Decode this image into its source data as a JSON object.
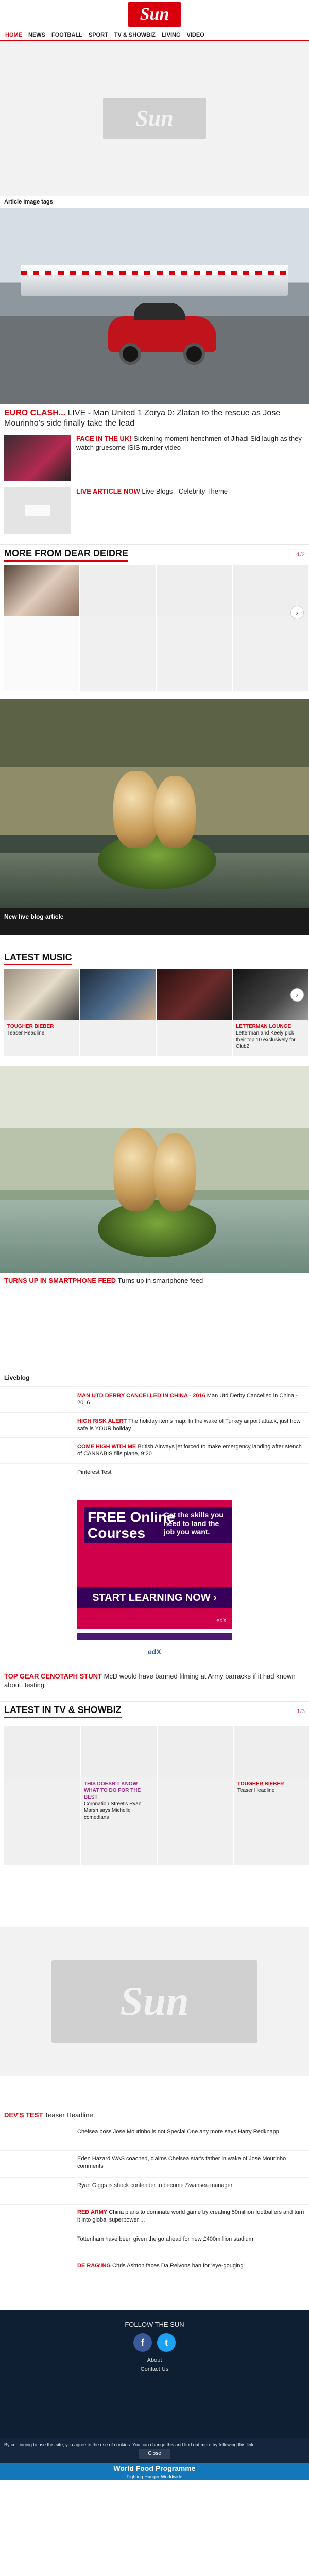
{
  "brand": {
    "name": "Sun"
  },
  "nav": [
    "Home",
    "News",
    "Football",
    "Sport",
    "TV & Showbiz",
    "Living",
    "Video"
  ],
  "article_image_tags": "Article Image tags",
  "hero": {
    "kicker": "EURO CLASH...",
    "headline": " LIVE - Man United 1 Zorya 0: Zlatan to the rescue as Jose Mourinho's side finally take the lead"
  },
  "stories": [
    {
      "kicker": "FACE IN THE UK!",
      "text": " Sickening moment henchmen of Jihadi Sid laugh as they watch gruesome ISIS murder video"
    },
    {
      "kicker": "LIVE ARTICLE NOW",
      "text": " Live Blogs - Celebrity Theme"
    }
  ],
  "more_from_dear_deidre": {
    "title": "More from Dear Deidre",
    "pager_current": "1",
    "pager_total": "2"
  },
  "blog_caption": "New live blog article",
  "latest_music": {
    "title": "Latest Music",
    "cards": [
      {
        "kicker": "TOUGHER BIEBER",
        "text": "Teaser Headline"
      },
      {
        "kicker": "",
        "text": ""
      },
      {
        "kicker": "",
        "text": ""
      },
      {
        "kicker": "LETTERMAN LOUNGE",
        "text": "Letterman and Keely pick their top 10 exclusively for Club2"
      }
    ]
  },
  "turns": {
    "kicker": "TURNS UP IN SMARTPHONE FEED",
    "text": " Turns up in smartphone feed"
  },
  "liveblog": {
    "title": "Liveblog",
    "items": [
      {
        "kicker": "MAN UTD DERBY CANCELLED IN CHINA - 2016",
        "text": " Man Utd Derby Cancelled in China - 2016"
      },
      {
        "kicker": "HIGH RISK ALERT",
        "text": " The holiday items map: In the wake of Turkey airport attack, just how safe is YOUR holiday"
      },
      {
        "kicker": "COME HIGH WITH ME",
        "text": " British Airways jet forced to make emergency landing after stench of CANNABIS fills plane, 9:20"
      },
      {
        "kicker": "",
        "text": "Pinterest Test"
      }
    ]
  },
  "promo": {
    "big": "FREE Online Courses",
    "right": "Get the skills you need to land the job you want.",
    "cta": "START LEARNING NOW ›",
    "brand": "edX"
  },
  "gear": {
    "kicker": "TOP GEAR CENOTAPH STUNT",
    "text": " McD would have banned filming at Army barracks if it had known about, testing"
  },
  "tv_showbiz": {
    "title": "Latest in TV & Showbiz",
    "pager_current": "1",
    "pager_total": "3",
    "cards": [
      {
        "kicker": "",
        "text": ""
      },
      {
        "kicker": "THIS DOESN'T KNOW WHAT TO DO FOR THE BEST",
        "text": "Coronation Street's Ryan Marsh says Michelle comedians"
      },
      {
        "kicker": "",
        "text": ""
      },
      {
        "kicker": "TOUGHER BIEBER",
        "text": "Teaser Headline"
      }
    ]
  },
  "devs": {
    "kicker": "DEV'S TEST",
    "text": " Teaser Headline"
  },
  "list": [
    {
      "kicker": "",
      "text": "Chelsea boss Jose Mourinho is not Special One any more says Harry Redknapp"
    },
    {
      "kicker": "",
      "text": "Eden Hazard WAS coached, claims Chelsea star's father in wake of Jose Mourinho comments"
    },
    {
      "kicker": "",
      "text": "Ryan Giggs is shock contender to become Swansea manager"
    },
    {
      "kicker": "RED ARMY",
      "text": " China plans to dominate world game by creating 50million footballers and turn it into global superpower ..."
    },
    {
      "kicker": "",
      "text": "Tottenham have been given the go ahead for new £400million stadium"
    },
    {
      "kicker": "DE RAG'ING",
      "text": " Chris Ashton faces Da Reivons ban for 'eye-gouging'"
    }
  ],
  "footer": {
    "follow": "FOLLOW THE SUN",
    "links": [
      "About",
      "Contact Us"
    ],
    "cookie_notice": "By continuing to use this site, you agree to the use of cookies. You can change this and find out more by following this link",
    "close": "Close",
    "wfp_title": "World Food Programme",
    "wfp_sub": "Fighting Hunger Worldwide"
  }
}
